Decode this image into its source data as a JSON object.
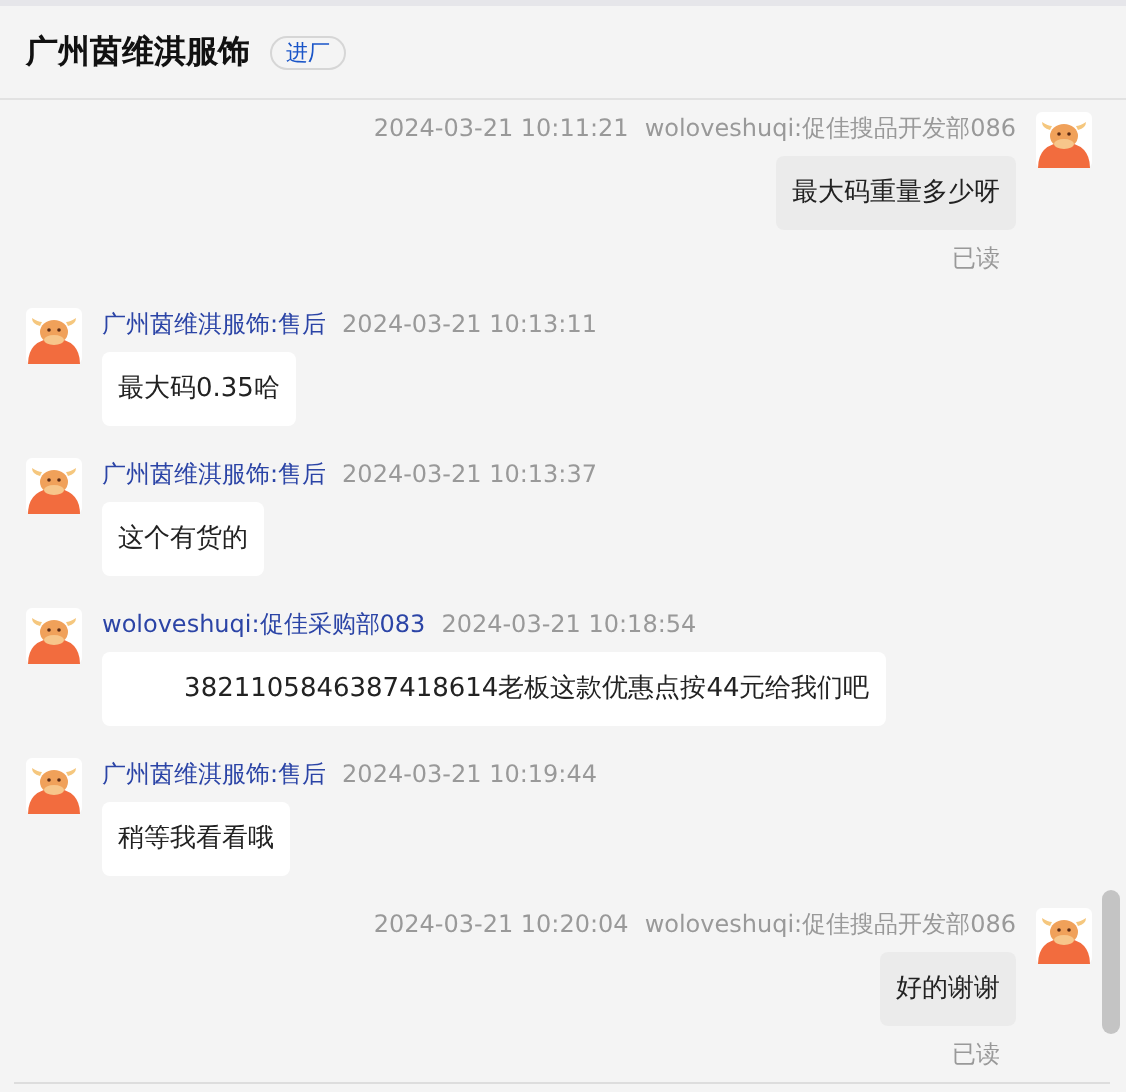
{
  "header": {
    "title": "广州茵维淇服饰",
    "badge": "进厂"
  },
  "messages": [
    {
      "kind": "sent",
      "time": "2024-03-21 10:11:21",
      "sender": "woloveshuqi:促佳搜品开发部086",
      "text": "最大码重量多少呀",
      "status": "已读"
    },
    {
      "kind": "received",
      "sender": "广州茵维淇服饰:售后",
      "time": "2024-03-21 10:13:11",
      "text": "最大码0.35哈"
    },
    {
      "kind": "received",
      "sender": "广州茵维淇服饰:售后",
      "time": "2024-03-21 10:13:37",
      "text": "这个有货的"
    },
    {
      "kind": "received",
      "sender": "woloveshuqi:促佳采购部083",
      "time": "2024-03-21 10:18:54",
      "text": "        3821105846387418614老板这款优惠点按44元给我们吧"
    },
    {
      "kind": "received",
      "sender": "广州茵维淇服饰:售后",
      "time": "2024-03-21 10:19:44",
      "text": "稍等我看看哦"
    },
    {
      "kind": "sent",
      "time": "2024-03-21 10:20:04",
      "sender": "woloveshuqi:促佳搜品开发部086",
      "text": "好的谢谢",
      "status": "已读"
    }
  ]
}
